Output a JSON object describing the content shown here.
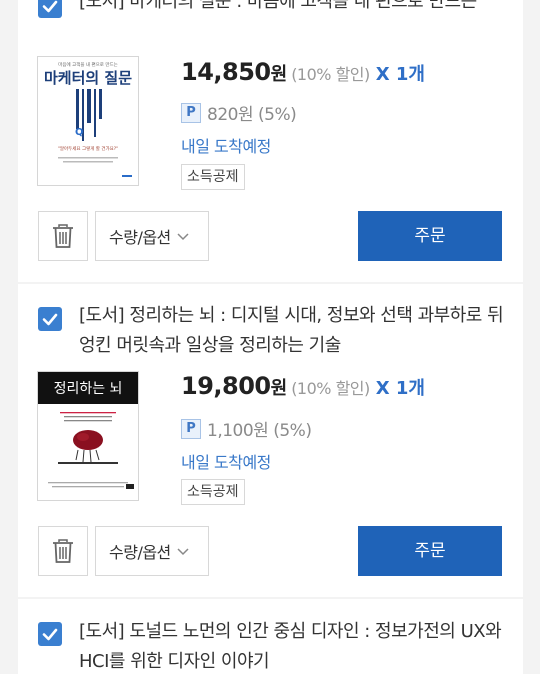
{
  "items": [
    {
      "title": "[도서] 마케터의 질문 : 마음에 고객을 내 편으로 만드는",
      "cover": {
        "top_text": "마음에 고객을 내 편으로 만드는",
        "title_text": "마케터의 질문",
        "q_letter": "Q",
        "tagline": "\"알아두세요 그렇게 할 건가요?\""
      },
      "price": "14,850",
      "won": "원",
      "discount": "(10% 할인)",
      "qty": "X 1개",
      "point_badge": "P",
      "point": "820원 (5%)",
      "delivery": "내일 도착예정",
      "tax": "소득공제",
      "option_label": "수량/옵션",
      "order_label": "주문"
    },
    {
      "title": "[도서] 정리하는 뇌 : 디지털 시대, 정보와 선택 과부하로 뒤엉킨 머릿속과 일상을 정리하는 기술",
      "cover": {
        "title_text": "정리하는 뇌"
      },
      "price": "19,800",
      "won": "원",
      "discount": "(10% 할인)",
      "qty": "X 1개",
      "point_badge": "P",
      "point": "1,100원 (5%)",
      "delivery": "내일 도착예정",
      "tax": "소득공제",
      "option_label": "수량/옵션",
      "order_label": "주문"
    },
    {
      "title": "[도서] 도널드 노먼의 인간 중심 디자인 : 정보가전의 UX와 HCI를 위한 디자인 이야기"
    }
  ],
  "colors": {
    "accent": "#1f63b8",
    "checkbox": "#3a7fd0",
    "link": "#3a79c9",
    "background": "#f3f3f3"
  },
  "icons": [
    "check-icon",
    "trash-icon",
    "chevron-down-icon",
    "point-icon"
  ]
}
